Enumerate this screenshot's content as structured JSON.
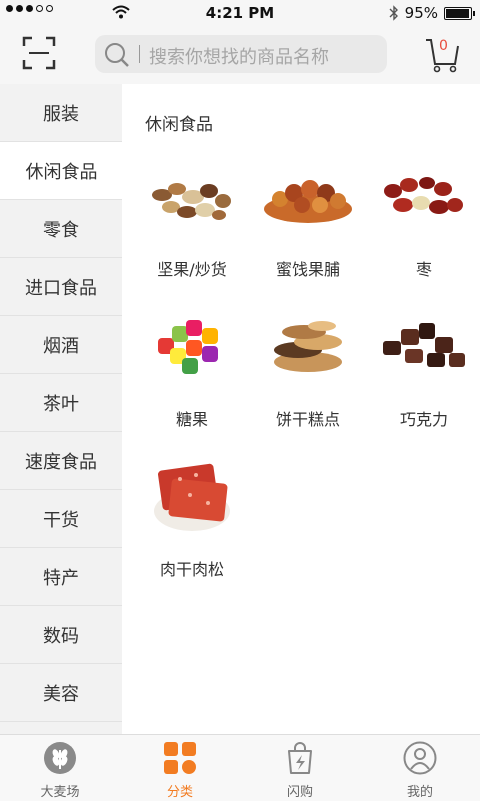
{
  "status_bar": {
    "time": "4:21 PM",
    "battery": "95%",
    "signal_icon": "signal-dots-icon",
    "wifi_icon": "wifi-icon",
    "bluetooth_icon": "bluetooth-icon"
  },
  "header": {
    "scan_icon": "scan-icon",
    "search_placeholder": "搜索你想找的商品名称",
    "cart_count": "0",
    "accent_color": "#e84c3d"
  },
  "sidebar": {
    "items": [
      {
        "label": "服装"
      },
      {
        "label": "休闲食品"
      },
      {
        "label": "零食"
      },
      {
        "label": "进口食品"
      },
      {
        "label": "烟酒"
      },
      {
        "label": "茶叶"
      },
      {
        "label": "速度食品"
      },
      {
        "label": "干货"
      },
      {
        "label": "特产"
      },
      {
        "label": "数码"
      },
      {
        "label": "美容"
      }
    ],
    "active_index": 1
  },
  "main": {
    "section_title": "休闲食品",
    "products": [
      {
        "label": "坚果/炒货",
        "image": "nuts-image"
      },
      {
        "label": "蜜饯果脯",
        "image": "dried-fruit-image"
      },
      {
        "label": "枣",
        "image": "jujube-image"
      },
      {
        "label": "糖果",
        "image": "candy-image"
      },
      {
        "label": "饼干糕点",
        "image": "biscuit-image"
      },
      {
        "label": "巧克力",
        "image": "chocolate-image"
      },
      {
        "label": "肉干肉松",
        "image": "jerky-image"
      }
    ]
  },
  "tabbar": {
    "tabs": [
      {
        "label": "大麦场",
        "icon": "wheat-icon"
      },
      {
        "label": "分类",
        "icon": "category-grid-icon"
      },
      {
        "label": "闪购",
        "icon": "flash-bag-icon"
      },
      {
        "label": "我的",
        "icon": "user-icon"
      }
    ],
    "active_index": 1,
    "active_color": "#f27c22"
  }
}
